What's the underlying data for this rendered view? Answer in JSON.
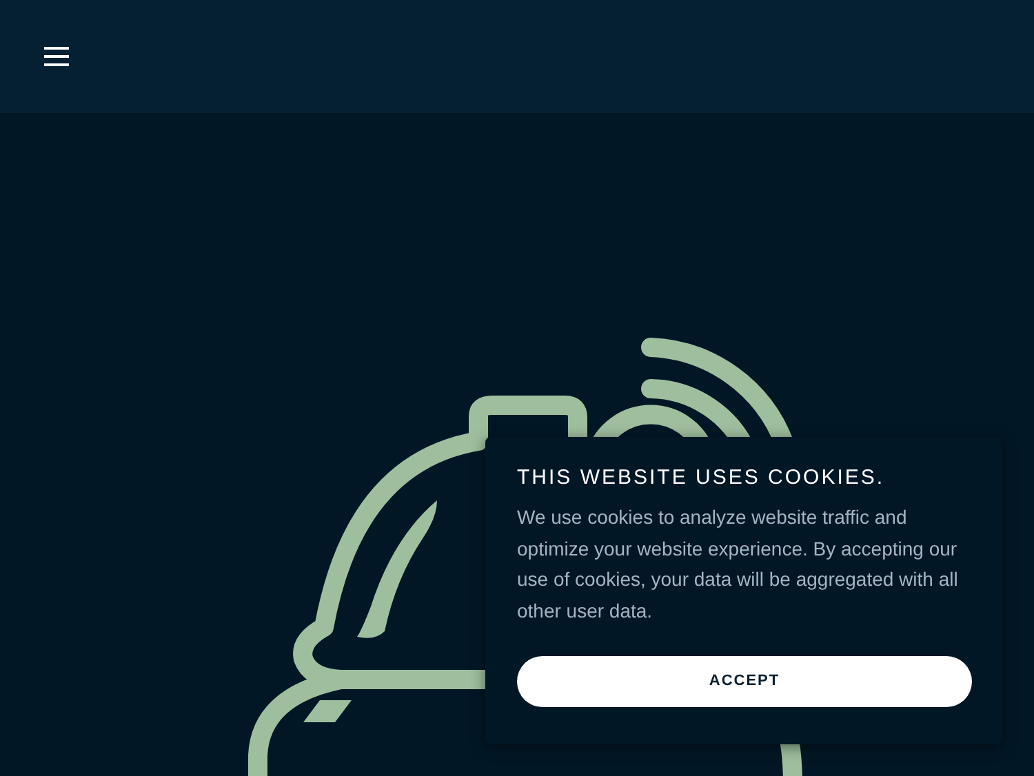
{
  "cookie_banner": {
    "title": "THIS WEBSITE USES COOKIES.",
    "message": "We use cookies to analyze website traffic and optimize your website experience. By accepting our use of cookies, your data will be aggregated with all other user data.",
    "button": "ACCEPT"
  }
}
